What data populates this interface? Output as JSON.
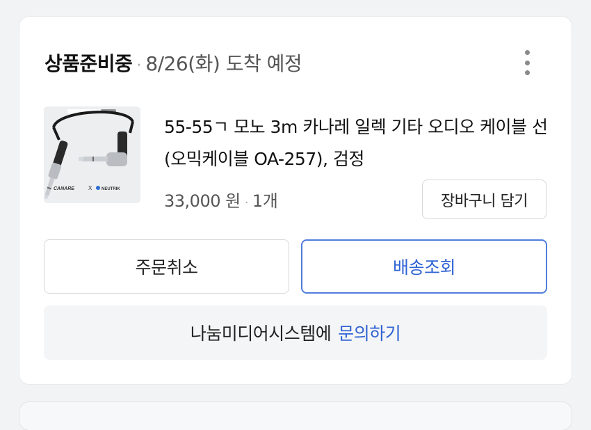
{
  "order": {
    "status_title": "상품준비중",
    "status_separator": "·",
    "eta": "8/26(화) 도착 예정",
    "more_icon": "more-vertical-icon"
  },
  "product": {
    "image_icon": "guitar-cable-product-image",
    "image_brand_left": "CANARE",
    "image_brand_x": "X",
    "image_brand_right": "NEUTRIK",
    "name": "55-55ㄱ 모노 3m 카나레 일렉 기타 오디오 케이블 선 (오믹케이블 OA-257), 검정",
    "price": "33,000 원",
    "price_separator": "·",
    "quantity": "1개",
    "cart_label": "장바구니 담기"
  },
  "actions": {
    "cancel_label": "주문취소",
    "track_label": "배송조회"
  },
  "inquiry": {
    "seller_text": "나눔미디어시스템에",
    "link_label": "문의하기"
  },
  "colors": {
    "accent": "#2f63d4",
    "border": "#d5d7db",
    "muted_text": "#555555",
    "card_background": "#ffffff",
    "page_background": "#f2f3f5"
  }
}
